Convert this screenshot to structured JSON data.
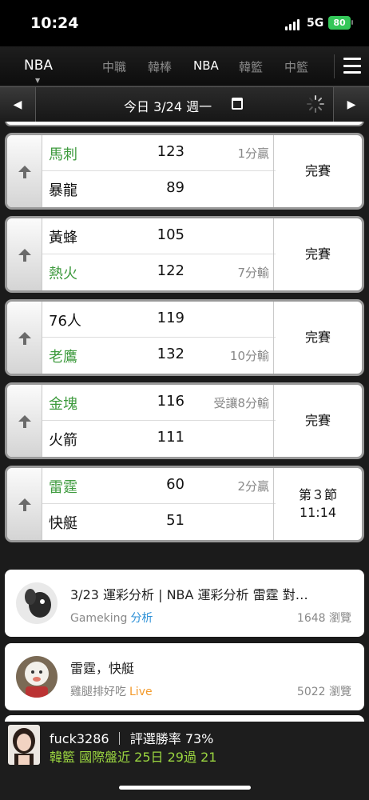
{
  "status_bar": {
    "time": "10:24",
    "network": "5G",
    "battery": "80"
  },
  "league_bar": {
    "current": "NBA",
    "tabs": [
      {
        "label": "中職",
        "active": false
      },
      {
        "label": "韓棒",
        "active": false
      },
      {
        "label": "NBA",
        "active": true
      },
      {
        "label": "韓籃",
        "active": false
      },
      {
        "label": "中籃",
        "active": false
      }
    ]
  },
  "date_bar": {
    "date_label": "今日 3/24 週一",
    "prev_icon": "triangle-left",
    "next_icon": "triangle-right"
  },
  "games": [
    {
      "home": {
        "name": "馬刺",
        "score": "123",
        "note": "1分贏",
        "win": true
      },
      "away": {
        "name": "暴龍",
        "score": "89",
        "note": "",
        "win": false
      },
      "status_line1": "完賽",
      "status_line2": ""
    },
    {
      "home": {
        "name": "黃蜂",
        "score": "105",
        "note": "",
        "win": false
      },
      "away": {
        "name": "熱火",
        "score": "122",
        "note": "7分輸",
        "win": true
      },
      "status_line1": "完賽",
      "status_line2": ""
    },
    {
      "home": {
        "name": "76人",
        "score": "119",
        "note": "",
        "win": false
      },
      "away": {
        "name": "老鷹",
        "score": "132",
        "note": "10分輸",
        "win": true
      },
      "status_line1": "完賽",
      "status_line2": ""
    },
    {
      "home": {
        "name": "金塊",
        "score": "116",
        "note": "受讓8分輸",
        "win": true
      },
      "away": {
        "name": "火箭",
        "score": "111",
        "note": "",
        "win": false
      },
      "status_line1": "完賽",
      "status_line2": ""
    },
    {
      "home": {
        "name": "雷霆",
        "score": "60",
        "note": "2分贏",
        "win": true
      },
      "away": {
        "name": "快艇",
        "score": "51",
        "note": "",
        "win": false
      },
      "status_line1": "第３節",
      "status_line2": "11:14"
    }
  ],
  "articles": [
    {
      "title": "3/23 運彩分析 | NBA 運彩分析 雷霆 對…",
      "author": "Gameking",
      "tag": "分析",
      "tag_color": "#2b8fd6",
      "views": "1648 瀏覽"
    },
    {
      "title": "雷霆，快艇",
      "author": "雞腿排好吃",
      "tag": "Live",
      "tag_color": "#f39a2b",
      "views": "5022 瀏覽"
    }
  ],
  "promo": {
    "line1": "fuck3286 ｜ 評選勝率 73%",
    "line2": "韓籃 國際盤近 25日 29過 21"
  },
  "colors": {
    "win_green": "#3d9a3d",
    "promo_green": "#9bd640"
  }
}
